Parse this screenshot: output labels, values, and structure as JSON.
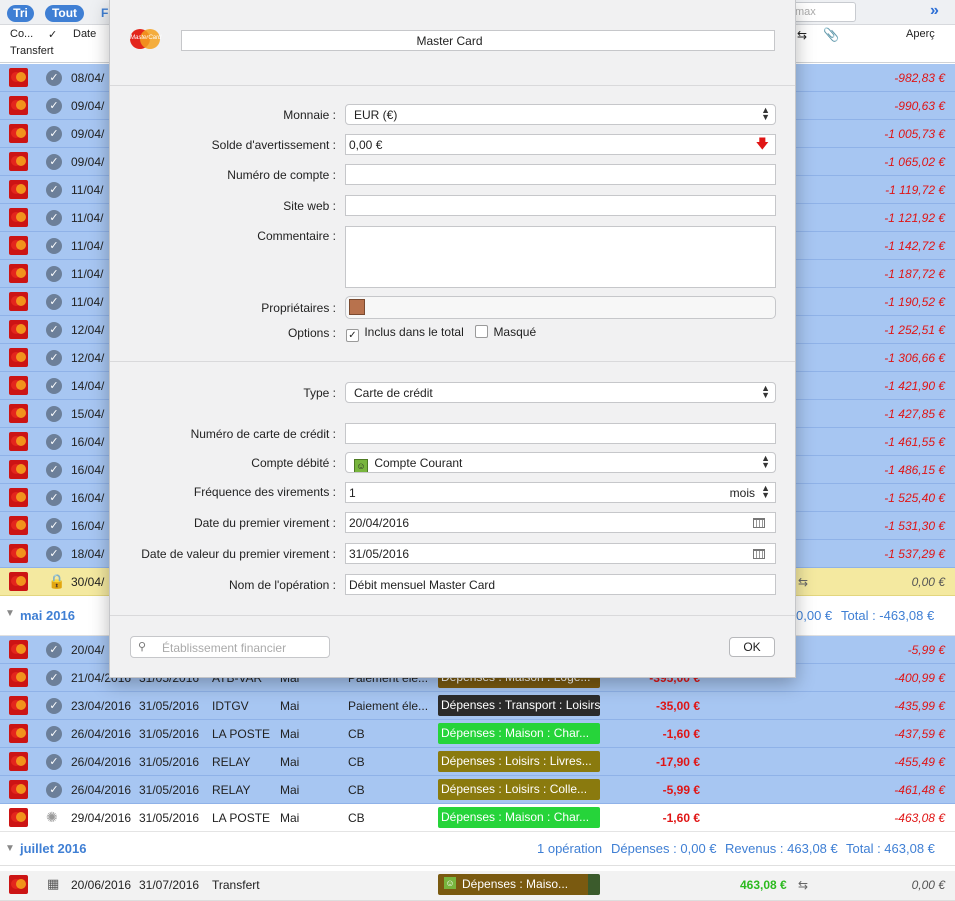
{
  "toolbar": {
    "sort_label": "Tri",
    "all_label": "Tout",
    "filter_label": "Fi",
    "max_placeholder": "max",
    "more_glyph": "»"
  },
  "columns": {
    "co": "Co...",
    "check": "✓",
    "date": "Date",
    "transfer": "Transfert",
    "apercu": "Aperç"
  },
  "background_rows": [
    {
      "date": "08/04/",
      "amount": "-982,83 €"
    },
    {
      "date": "09/04/",
      "amount": "-990,63 €"
    },
    {
      "date": "09/04/",
      "amount": "-1 005,73 €"
    },
    {
      "date": "09/04/",
      "amount": "-1 065,02 €"
    },
    {
      "date": "11/04/",
      "amount": "-1 119,72 €"
    },
    {
      "date": "11/04/",
      "amount": "-1 121,92 €"
    },
    {
      "date": "11/04/",
      "amount": "-1 142,72 €"
    },
    {
      "date": "11/04/",
      "amount": "-1 187,72 €"
    },
    {
      "date": "11/04/",
      "amount": "-1 190,52 €"
    },
    {
      "date": "12/04/",
      "amount": "-1 252,51 €"
    },
    {
      "date": "12/04/",
      "amount": "-1 306,66 €"
    },
    {
      "date": "14/04/",
      "amount": "-1 421,90 €"
    },
    {
      "date": "15/04/",
      "amount": "-1 427,85 €"
    },
    {
      "date": "16/04/",
      "amount": "-1 461,55 €"
    },
    {
      "date": "16/04/",
      "amount": "-1 486,15 €"
    },
    {
      "date": "16/04/",
      "amount": "-1 525,40 €"
    },
    {
      "date": "16/04/",
      "amount": "-1 531,30 €"
    },
    {
      "date": "18/04/",
      "amount": "-1 537,29 €"
    }
  ],
  "locked_row": {
    "date": "30/04/",
    "amount": "0,00 €"
  },
  "group_mai": {
    "title": "mai 2016",
    "revenus": "0,00 €",
    "total": "Total : -463,08 €"
  },
  "mai_rows": [
    {
      "date": "20/04/",
      "amount": "",
      "balance": "-5,99 €"
    },
    {
      "date": "21/04/2016",
      "value_date": "31/05/2016",
      "payee": "ATB-VAR",
      "month": "Mai",
      "mode": "Paiement éle...",
      "category": "Dépenses : Maison : Loge...",
      "amount": "-395,00 €",
      "balance": "-400,99 €"
    },
    {
      "date": "23/04/2016",
      "value_date": "31/05/2016",
      "payee": "IDTGV",
      "month": "Mai",
      "mode": "Paiement éle...",
      "category": "Dépenses : Transport : Loisirs",
      "amount": "-35,00 €",
      "balance": "-435,99 €"
    },
    {
      "date": "26/04/2016",
      "value_date": "31/05/2016",
      "payee": "LA POSTE",
      "month": "Mai",
      "mode": "CB",
      "category": "Dépenses : Maison : Char...",
      "amount": "-1,60 €",
      "balance": "-437,59 €"
    },
    {
      "date": "26/04/2016",
      "value_date": "31/05/2016",
      "payee": "RELAY",
      "month": "Mai",
      "mode": "CB",
      "category": "Dépenses : Loisirs : Livres...",
      "amount": "-17,90 €",
      "balance": "-455,49 €"
    },
    {
      "date": "26/04/2016",
      "value_date": "31/05/2016",
      "payee": "RELAY",
      "month": "Mai",
      "mode": "CB",
      "category": "Dépenses : Loisirs : Colle...",
      "amount": "-5,99 €",
      "balance": "-461,48 €"
    },
    {
      "date": "29/04/2016",
      "value_date": "31/05/2016",
      "payee": "LA POSTE",
      "month": "Mai",
      "mode": "CB",
      "category": "Dépenses : Maison : Char...",
      "amount": "-1,60 €",
      "balance": "-463,08 €"
    }
  ],
  "group_juillet": {
    "title": "juillet 2016",
    "count": "1 opération",
    "depenses": "Dépenses : 0,00 €",
    "revenus": "Revenus : 463,08 €",
    "total": "Total : 463,08 €"
  },
  "juillet_row": {
    "date": "20/06/2016",
    "value_date": "31/07/2016",
    "payee": "Transfert",
    "category": "Dépenses : Maiso...",
    "amount": "463,08 €",
    "balance": "0,00 €"
  },
  "colors": {
    "row_selected": "#a7c6f2",
    "negative": "#e01515",
    "positive": "#2cba1f",
    "accent": "#3f7fd4"
  },
  "modal": {
    "account_name": "Master Card",
    "logo_text": "MasterCard",
    "labels": {
      "currency": "Monnaie :",
      "warning_balance": "Solde d'avertissement :",
      "account_number": "Numéro de compte :",
      "website": "Site web :",
      "comment": "Commentaire :",
      "owners": "Propriétaires :",
      "options": "Options :",
      "type": "Type :",
      "card_number": "Numéro de carte de crédit :",
      "debited_account": "Compte débité :",
      "transfer_frequency": "Fréquence des virements :",
      "first_transfer_date": "Date du premier virement :",
      "first_value_date": "Date de valeur du premier virement :",
      "operation_name": "Nom de l'opération :"
    },
    "values": {
      "currency": "EUR (€)",
      "warning_balance": "0,00 €",
      "account_number": "",
      "website": "",
      "comment": "",
      "include_total": "Inclus dans le total",
      "hidden": "Masqué",
      "type": "Carte de crédit",
      "card_number": "",
      "debited_account": "Compte Courant",
      "frequency": "1",
      "frequency_unit": "mois",
      "first_transfer_date": "20/04/2016",
      "first_value_date": "31/05/2016",
      "operation_name": "Débit mensuel Master Card"
    },
    "search_placeholder": "Établissement financier",
    "ok_label": "OK"
  }
}
